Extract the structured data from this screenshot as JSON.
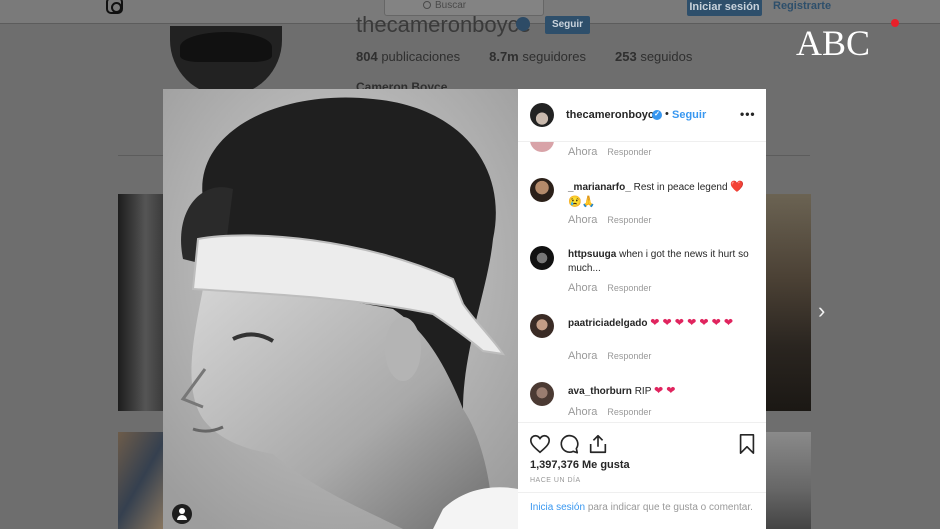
{
  "background_page": {
    "search_placeholder": "Buscar",
    "login_button": "Iniciar sesión",
    "register_link": "Registrarte",
    "profile_username": "thecameronboyce",
    "follow_button": "Seguir",
    "stats": {
      "posts_count": "804",
      "posts_label": "publicaciones",
      "followers_count": "8.7m",
      "followers_label": "seguidores",
      "following_count": "253",
      "following_label": "seguidos"
    },
    "full_name": "Cameron Boyce"
  },
  "watermark": {
    "brand": "ABC",
    "dot_color": "#e8202a"
  },
  "post": {
    "username": "thecameronboyce",
    "verified": true,
    "separator": "•",
    "follow_label": "Seguir",
    "more_label": "•••",
    "comments": [
      {
        "user": "",
        "text": "",
        "time": "Ahora",
        "reply": "Responder"
      },
      {
        "user": "_marianarfo_",
        "text": "Rest in peace legend",
        "emoji": "❤️ 😢🙏",
        "time": "Ahora",
        "reply": "Responder"
      },
      {
        "user": "httpsuuga",
        "text": "when i got the news it hurt so much...",
        "emoji": "",
        "time": "Ahora",
        "reply": "Responder"
      },
      {
        "user": "paatriciadelgado",
        "text": "",
        "emoji": "❤ ❤ ❤ ❤ ❤ ❤ ❤",
        "time": "Ahora",
        "reply": "Responder"
      },
      {
        "user": "ava_thorburn",
        "text": "RIP",
        "emoji": "❤ ❤",
        "time": "Ahora",
        "reply": "Responder"
      }
    ],
    "likes": "1,397,376 Me gusta",
    "timestamp": "HACE UN DÍA",
    "login_link": "Inicia sesión",
    "login_prompt": "para indicar que te gusta o comentar.",
    "accent_color": "#3897f0",
    "icons": [
      "heart-icon",
      "comment-icon",
      "share-icon",
      "bookmark-icon",
      "user-tag-icon",
      "chevron-right-icon"
    ]
  }
}
